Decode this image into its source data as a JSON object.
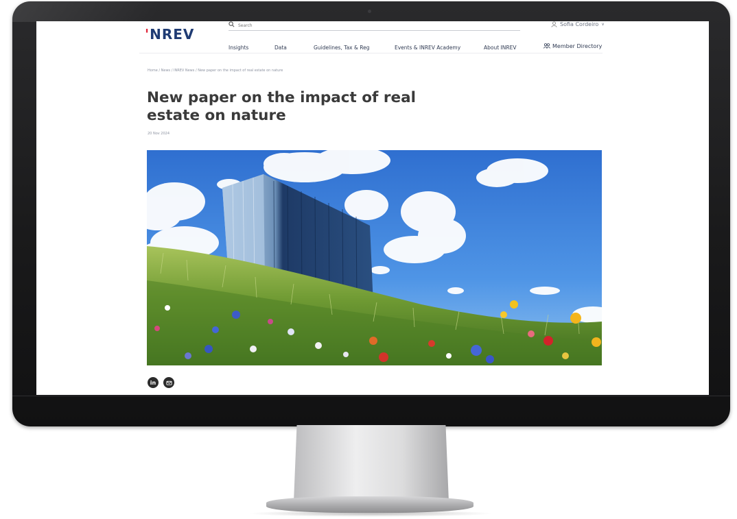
{
  "header": {
    "logo_mark": "'",
    "logo_text": "NREV",
    "search_placeholder": "Search",
    "user_name": "Sofia Cordeiro",
    "user_chevron": "∨"
  },
  "nav": {
    "items": [
      {
        "label": "Insights"
      },
      {
        "label": "Data"
      },
      {
        "label": "Guidelines, Tax & Reg"
      },
      {
        "label": "Events & INREV Academy"
      },
      {
        "label": "About INREV"
      }
    ],
    "member_directory": "Member Directory"
  },
  "breadcrumb": "Home / News / INREV News / New paper on the impact of real estate on nature",
  "article": {
    "title": "New paper on the impact of real estate on nature",
    "date": "20 Nov 2024"
  },
  "share": {
    "linkedin": "in",
    "email_icon": "mail-icon"
  },
  "colors": {
    "logo_blue": "#1f3b73",
    "logo_red": "#e0263a",
    "nav_text": "#2f3a52",
    "title_text": "#3a3a3a",
    "bezel": "#1a1a1b"
  }
}
